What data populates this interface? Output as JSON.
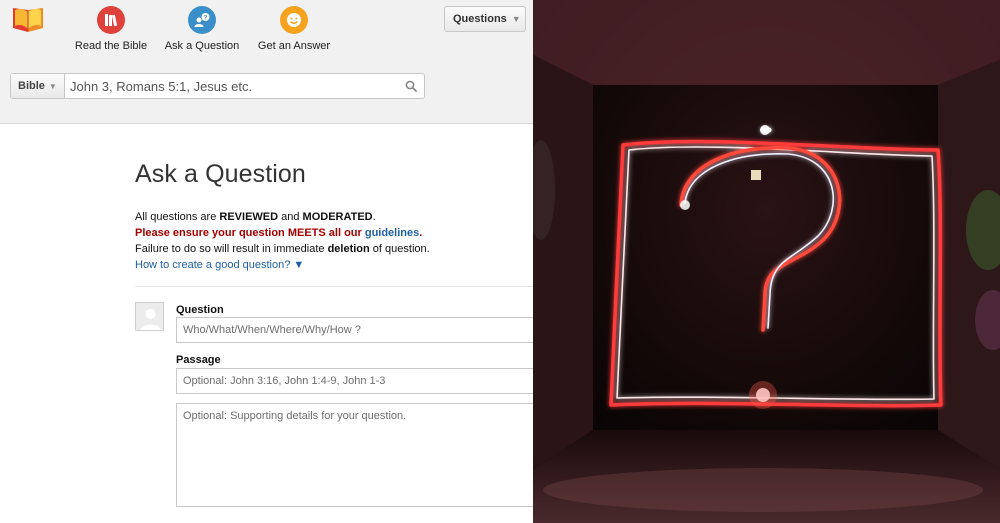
{
  "nav": {
    "read_label": "Read the Bible",
    "ask_label": "Ask a Question",
    "answer_label": "Get an Answer"
  },
  "header_dropdown": {
    "label": "Questions"
  },
  "search": {
    "scope": "Bible",
    "placeholder": "John 3, Romans 5:1, Jesus etc."
  },
  "page": {
    "title": "Ask a Question",
    "line1_prefix": "All questions are ",
    "line1_reviewed": "REVIEWED",
    "line1_and": " and ",
    "line1_moderated": "MODERATED",
    "line1_end": ".",
    "line2_red": "Please ensure your question MEETS all our ",
    "line2_link": "guidelines",
    "line2_end": ".",
    "line3_prefix": "Failure to do so will result in immediate ",
    "line3_bold": "deletion",
    "line3_end": " of question.",
    "how_link": "How to create a good question? ▼"
  },
  "form": {
    "question_label": "Question",
    "question_placeholder": "Who/What/When/Where/Why/How ?",
    "passage_label": "Passage",
    "passage_placeholder": "Optional: John 3:16, John 1:4-9, John 1-3",
    "details_placeholder": "Optional: Supporting details for your question."
  },
  "colors": {
    "read_icon": "#e0413a",
    "ask_icon": "#3a8fc9",
    "answer_icon": "#f5a21e",
    "link": "#1f5fa6",
    "warning": "#a40000"
  },
  "icons": [
    "book-logo-icon",
    "books-icon",
    "people-question-icon",
    "smiley-icon",
    "search-icon",
    "user-placeholder-icon"
  ]
}
